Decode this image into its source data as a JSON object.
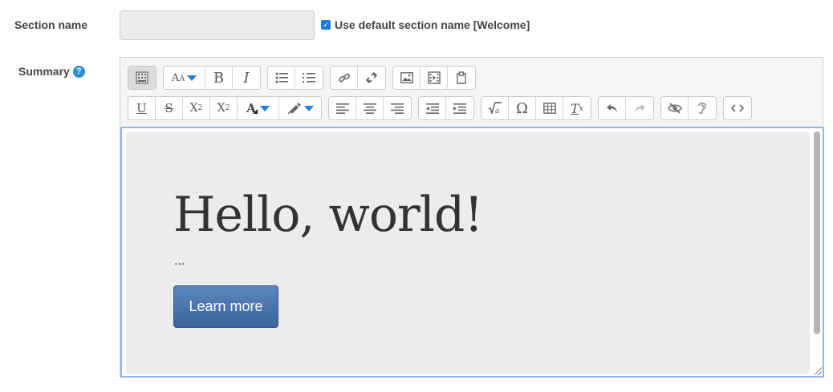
{
  "form": {
    "section_name_label": "Section name",
    "section_name_value": "",
    "use_default_label": "Use default section name [Welcome]",
    "use_default_checked": true,
    "summary_label": "Summary",
    "help_glyph": "?"
  },
  "toolbar": {
    "row1": [
      {
        "icon": "show-more-buttons-icon",
        "active": true
      },
      {
        "icon": "font-size-icon",
        "has_caret": true
      },
      {
        "icon": "bold-icon",
        "glyph": "B"
      },
      {
        "icon": "italic-icon",
        "glyph": "I"
      },
      {
        "icon": "unordered-list-icon"
      },
      {
        "icon": "ordered-list-icon"
      },
      {
        "icon": "link-icon"
      },
      {
        "icon": "unlink-icon"
      },
      {
        "icon": "image-icon"
      },
      {
        "icon": "media-icon"
      },
      {
        "icon": "manage-files-icon"
      }
    ],
    "row2": [
      {
        "icon": "underline-icon",
        "glyph": "U"
      },
      {
        "icon": "strikethrough-icon",
        "glyph": "S"
      },
      {
        "icon": "subscript-icon",
        "glyph": "X",
        "sub": "2"
      },
      {
        "icon": "superscript-icon",
        "glyph": "X",
        "sup": "2"
      },
      {
        "icon": "font-color-icon",
        "has_caret": true
      },
      {
        "icon": "background-color-icon",
        "has_caret": true
      },
      {
        "icon": "align-left-icon"
      },
      {
        "icon": "align-center-icon"
      },
      {
        "icon": "align-right-icon"
      },
      {
        "icon": "outdent-icon"
      },
      {
        "icon": "indent-icon"
      },
      {
        "icon": "equation-icon"
      },
      {
        "icon": "special-character-icon",
        "glyph": "Ω"
      },
      {
        "icon": "table-icon"
      },
      {
        "icon": "clear-formatting-icon",
        "glyph": "T",
        "sub": "x"
      },
      {
        "icon": "undo-icon"
      },
      {
        "icon": "redo-icon",
        "disabled": true
      },
      {
        "icon": "accessibility-checker-icon"
      },
      {
        "icon": "screenreader-helper-icon"
      },
      {
        "icon": "html-source-icon"
      }
    ]
  },
  "content": {
    "heading": "Hello, world!",
    "ellipsis": "...",
    "button_label": "Learn more"
  },
  "colors": {
    "accent": "#1a7de0",
    "focus_border": "#8fb4ea",
    "cta_bg": "#4a72a8",
    "content_bg": "#ececec"
  }
}
